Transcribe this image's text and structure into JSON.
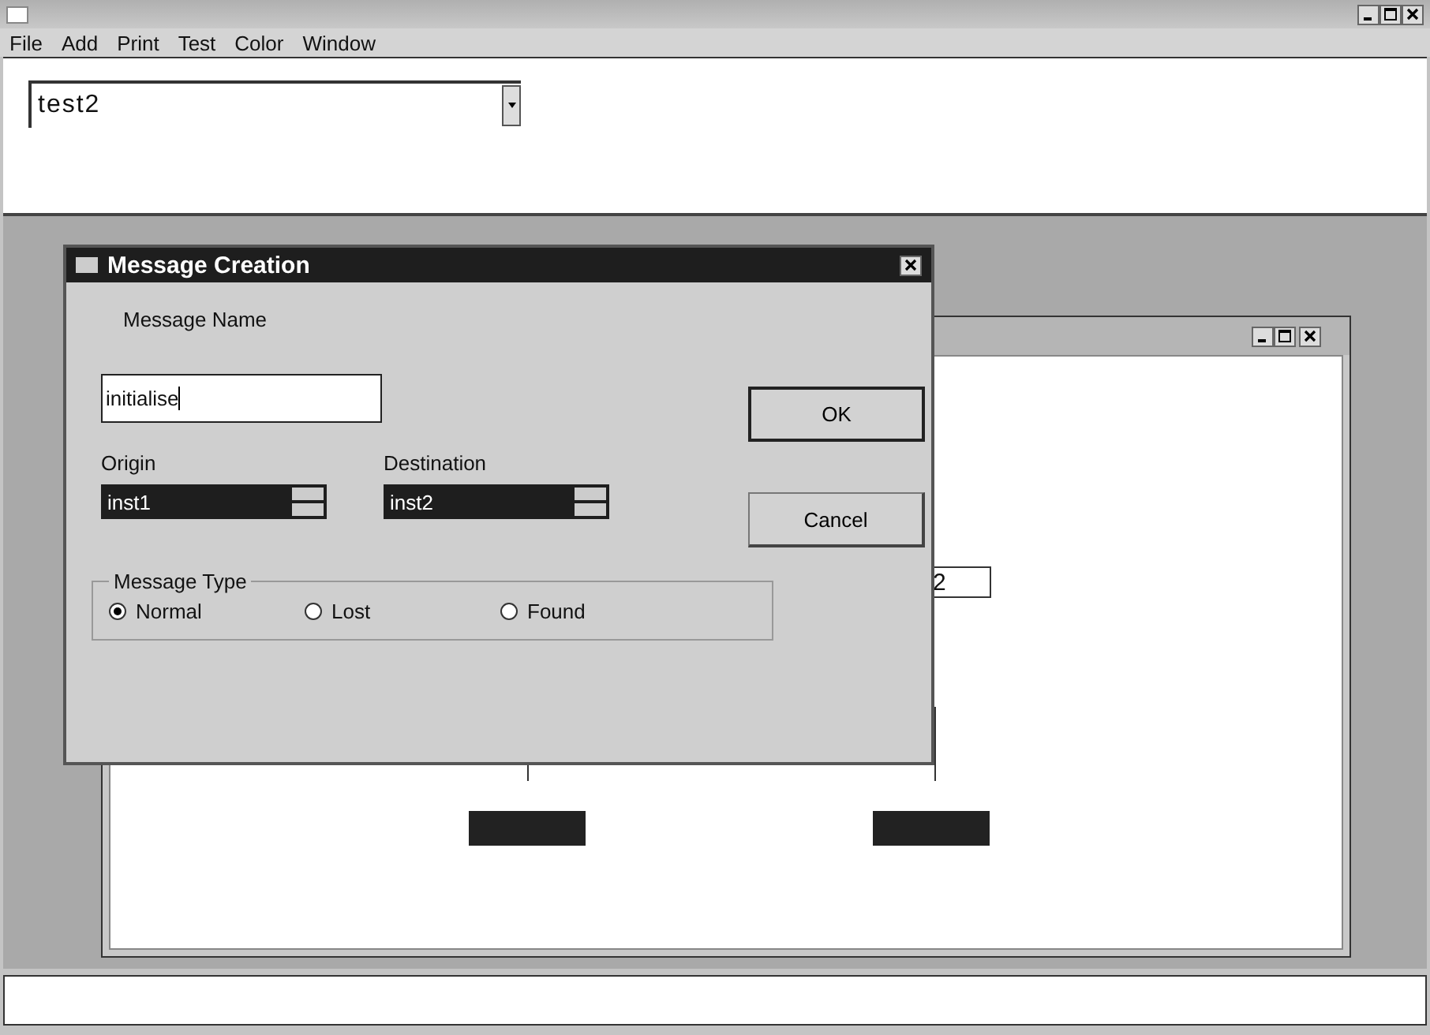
{
  "menu": [
    {
      "label": "File"
    },
    {
      "label": "Add"
    },
    {
      "label": "Print"
    },
    {
      "label": "Test"
    },
    {
      "label": "Color"
    },
    {
      "label": "Window"
    }
  ],
  "toolbar": {
    "combo_value": "test2"
  },
  "diagram": {
    "visible_label": "2"
  },
  "dialog": {
    "title": "Message Creation",
    "name_label": "Message Name",
    "name_value": "initialise",
    "origin": {
      "label": "Origin",
      "value": "inst1"
    },
    "destination": {
      "label": "Destination",
      "value": "inst2"
    },
    "buttons": [
      {
        "label": "OK",
        "default": true
      },
      {
        "label": "Cancel",
        "default": false
      }
    ],
    "message_type": {
      "label": "Message Type",
      "options": [
        {
          "label": "Normal",
          "selected": true
        },
        {
          "label": "Lost",
          "selected": false
        },
        {
          "label": "Found",
          "selected": false
        }
      ]
    }
  }
}
